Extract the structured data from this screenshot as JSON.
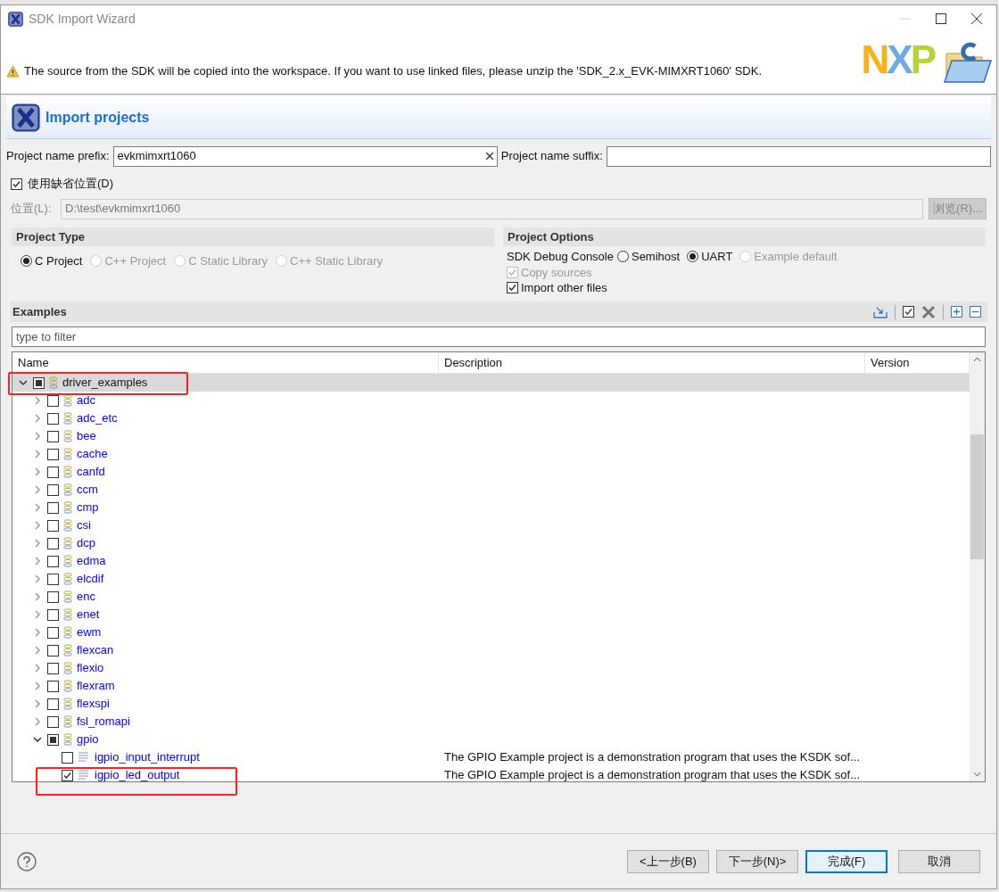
{
  "window": {
    "title": "SDK Import Wizard"
  },
  "banner": {
    "message": "The source from the SDK will be copied into the workspace. If you want to use linked files, please unzip the 'SDK_2.x_EVK-MIMXRT1060' SDK.",
    "logo": "NXP"
  },
  "page_title": "Import projects",
  "name_fields": [
    {
      "label": "Project name prefix:",
      "value": "evkmimxrt1060"
    },
    {
      "label": "Project name suffix:"
    }
  ],
  "default_location": {
    "label": "使用缺省位置(D)",
    "checked": true
  },
  "location": {
    "label": "位置(L):",
    "value": "D:\\test\\evkmimxrt1060",
    "disabled": true,
    "browse_button": "浏览(R)..."
  },
  "project_type": {
    "title": "Project Type",
    "options": [
      {
        "label": "C Project",
        "selected": true,
        "disabled": false
      },
      {
        "label": "C++ Project",
        "selected": false,
        "disabled": true
      },
      {
        "label": "C Static Library",
        "selected": false,
        "disabled": true
      },
      {
        "label": "C++ Static Library",
        "selected": false,
        "disabled": true
      }
    ]
  },
  "project_options": {
    "title": "Project Options",
    "debug_console": {
      "label": "SDK Debug Console",
      "options": [
        {
          "label": "Semihost",
          "selected": false,
          "disabled": false
        },
        {
          "label": "UART",
          "selected": true,
          "disabled": false
        },
        {
          "label": "Example default",
          "selected": false,
          "disabled": true
        }
      ]
    },
    "checkboxes": [
      {
        "label": "Copy sources",
        "checked": true,
        "disabled": true
      },
      {
        "label": "Import other files",
        "checked": true,
        "disabled": false
      }
    ]
  },
  "examples": {
    "title": "Examples",
    "filter_placeholder": "type to filter",
    "columns": [
      "Name",
      "Description",
      "Version"
    ],
    "tree": [
      {
        "name": "driver_examples",
        "kind": "group",
        "expanded": true,
        "checked": false,
        "partial": true,
        "selected": true,
        "children": [
          {
            "name": "adc",
            "kind": "group",
            "expanded": false,
            "checked": false,
            "partial": false,
            "selected": false
          },
          {
            "name": "adc_etc",
            "kind": "group",
            "expanded": false,
            "checked": false,
            "partial": false,
            "selected": false
          },
          {
            "name": "bee",
            "kind": "group",
            "expanded": false,
            "checked": false,
            "partial": false,
            "selected": false
          },
          {
            "name": "cache",
            "kind": "group",
            "expanded": false,
            "checked": false,
            "partial": false,
            "selected": false
          },
          {
            "name": "canfd",
            "kind": "group",
            "expanded": false,
            "checked": false,
            "partial": false,
            "selected": false
          },
          {
            "name": "ccm",
            "kind": "group",
            "expanded": false,
            "checked": false,
            "partial": false,
            "selected": false
          },
          {
            "name": "cmp",
            "kind": "group",
            "expanded": false,
            "checked": false,
            "partial": false,
            "selected": false
          },
          {
            "name": "csi",
            "kind": "group",
            "expanded": false,
            "checked": false,
            "partial": false,
            "selected": false
          },
          {
            "name": "dcp",
            "kind": "group",
            "expanded": false,
            "checked": false,
            "partial": false,
            "selected": false
          },
          {
            "name": "edma",
            "kind": "group",
            "expanded": false,
            "checked": false,
            "partial": false,
            "selected": false
          },
          {
            "name": "elcdif",
            "kind": "group",
            "expanded": false,
            "checked": false,
            "partial": false,
            "selected": false
          },
          {
            "name": "enc",
            "kind": "group",
            "expanded": false,
            "checked": false,
            "partial": false,
            "selected": false
          },
          {
            "name": "enet",
            "kind": "group",
            "expanded": false,
            "checked": false,
            "partial": false,
            "selected": false
          },
          {
            "name": "ewm",
            "kind": "group",
            "expanded": false,
            "checked": false,
            "partial": false,
            "selected": false
          },
          {
            "name": "flexcan",
            "kind": "group",
            "expanded": false,
            "checked": false,
            "partial": false,
            "selected": false
          },
          {
            "name": "flexio",
            "kind": "group",
            "expanded": false,
            "checked": false,
            "partial": false,
            "selected": false
          },
          {
            "name": "flexram",
            "kind": "group",
            "expanded": false,
            "checked": false,
            "partial": false,
            "selected": false
          },
          {
            "name": "flexspi",
            "kind": "group",
            "expanded": false,
            "checked": false,
            "partial": false,
            "selected": false
          },
          {
            "name": "fsl_romapi",
            "kind": "group",
            "expanded": false,
            "checked": false,
            "partial": false,
            "selected": false
          },
          {
            "name": "gpio",
            "kind": "group",
            "expanded": true,
            "checked": false,
            "partial": true,
            "selected": false,
            "children": [
              {
                "name": "igpio_input_interrupt",
                "kind": "example",
                "checked": false,
                "partial": false,
                "selected": false,
                "description": "The GPIO Example project is a demonstration program that uses the KSDK sof..."
              },
              {
                "name": "igpio_led_output",
                "kind": "example",
                "checked": true,
                "partial": false,
                "selected": false,
                "description": "The GPIO Example project is a demonstration program that uses the KSDK sof..."
              }
            ]
          }
        ]
      }
    ]
  },
  "buttons": [
    {
      "label": "<上一步(B)",
      "default": false
    },
    {
      "label": "下一步(N)>",
      "default": false
    },
    {
      "label": "完成(F)",
      "default": true
    },
    {
      "label": "取消",
      "default": false
    }
  ]
}
